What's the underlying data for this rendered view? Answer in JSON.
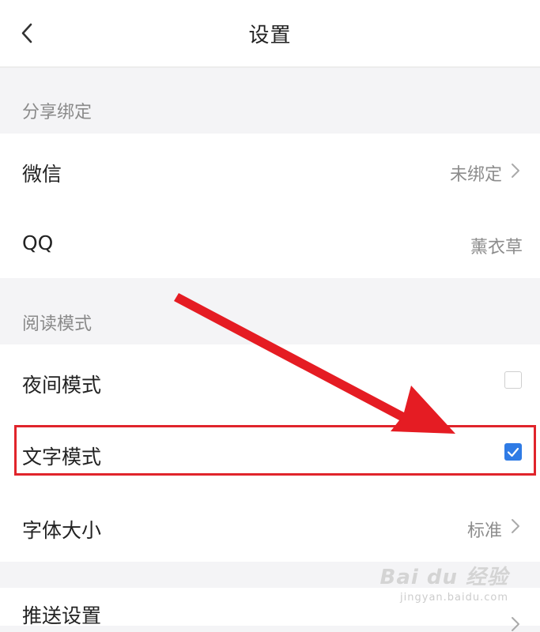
{
  "header": {
    "title": "设置"
  },
  "sections": {
    "share_binding": {
      "label": "分享绑定",
      "rows": {
        "wechat": {
          "label": "微信",
          "value": "未绑定"
        },
        "qq": {
          "label": "QQ",
          "value": "薰衣草"
        }
      }
    },
    "reading_mode": {
      "label": "阅读模式",
      "rows": {
        "night_mode": {
          "label": "夜间模式",
          "checked": false
        },
        "text_mode": {
          "label": "文字模式",
          "checked": true
        },
        "font_size": {
          "label": "字体大小",
          "value": "标准"
        }
      }
    },
    "push": {
      "rows": {
        "push_settings": {
          "label": "推送设置"
        }
      }
    }
  },
  "annotation": {
    "color": "#e0242b"
  },
  "accent_color": "#2f7be5",
  "watermark": {
    "brand": "Bai du 经验",
    "sub": "jingyan.baidu.com"
  }
}
